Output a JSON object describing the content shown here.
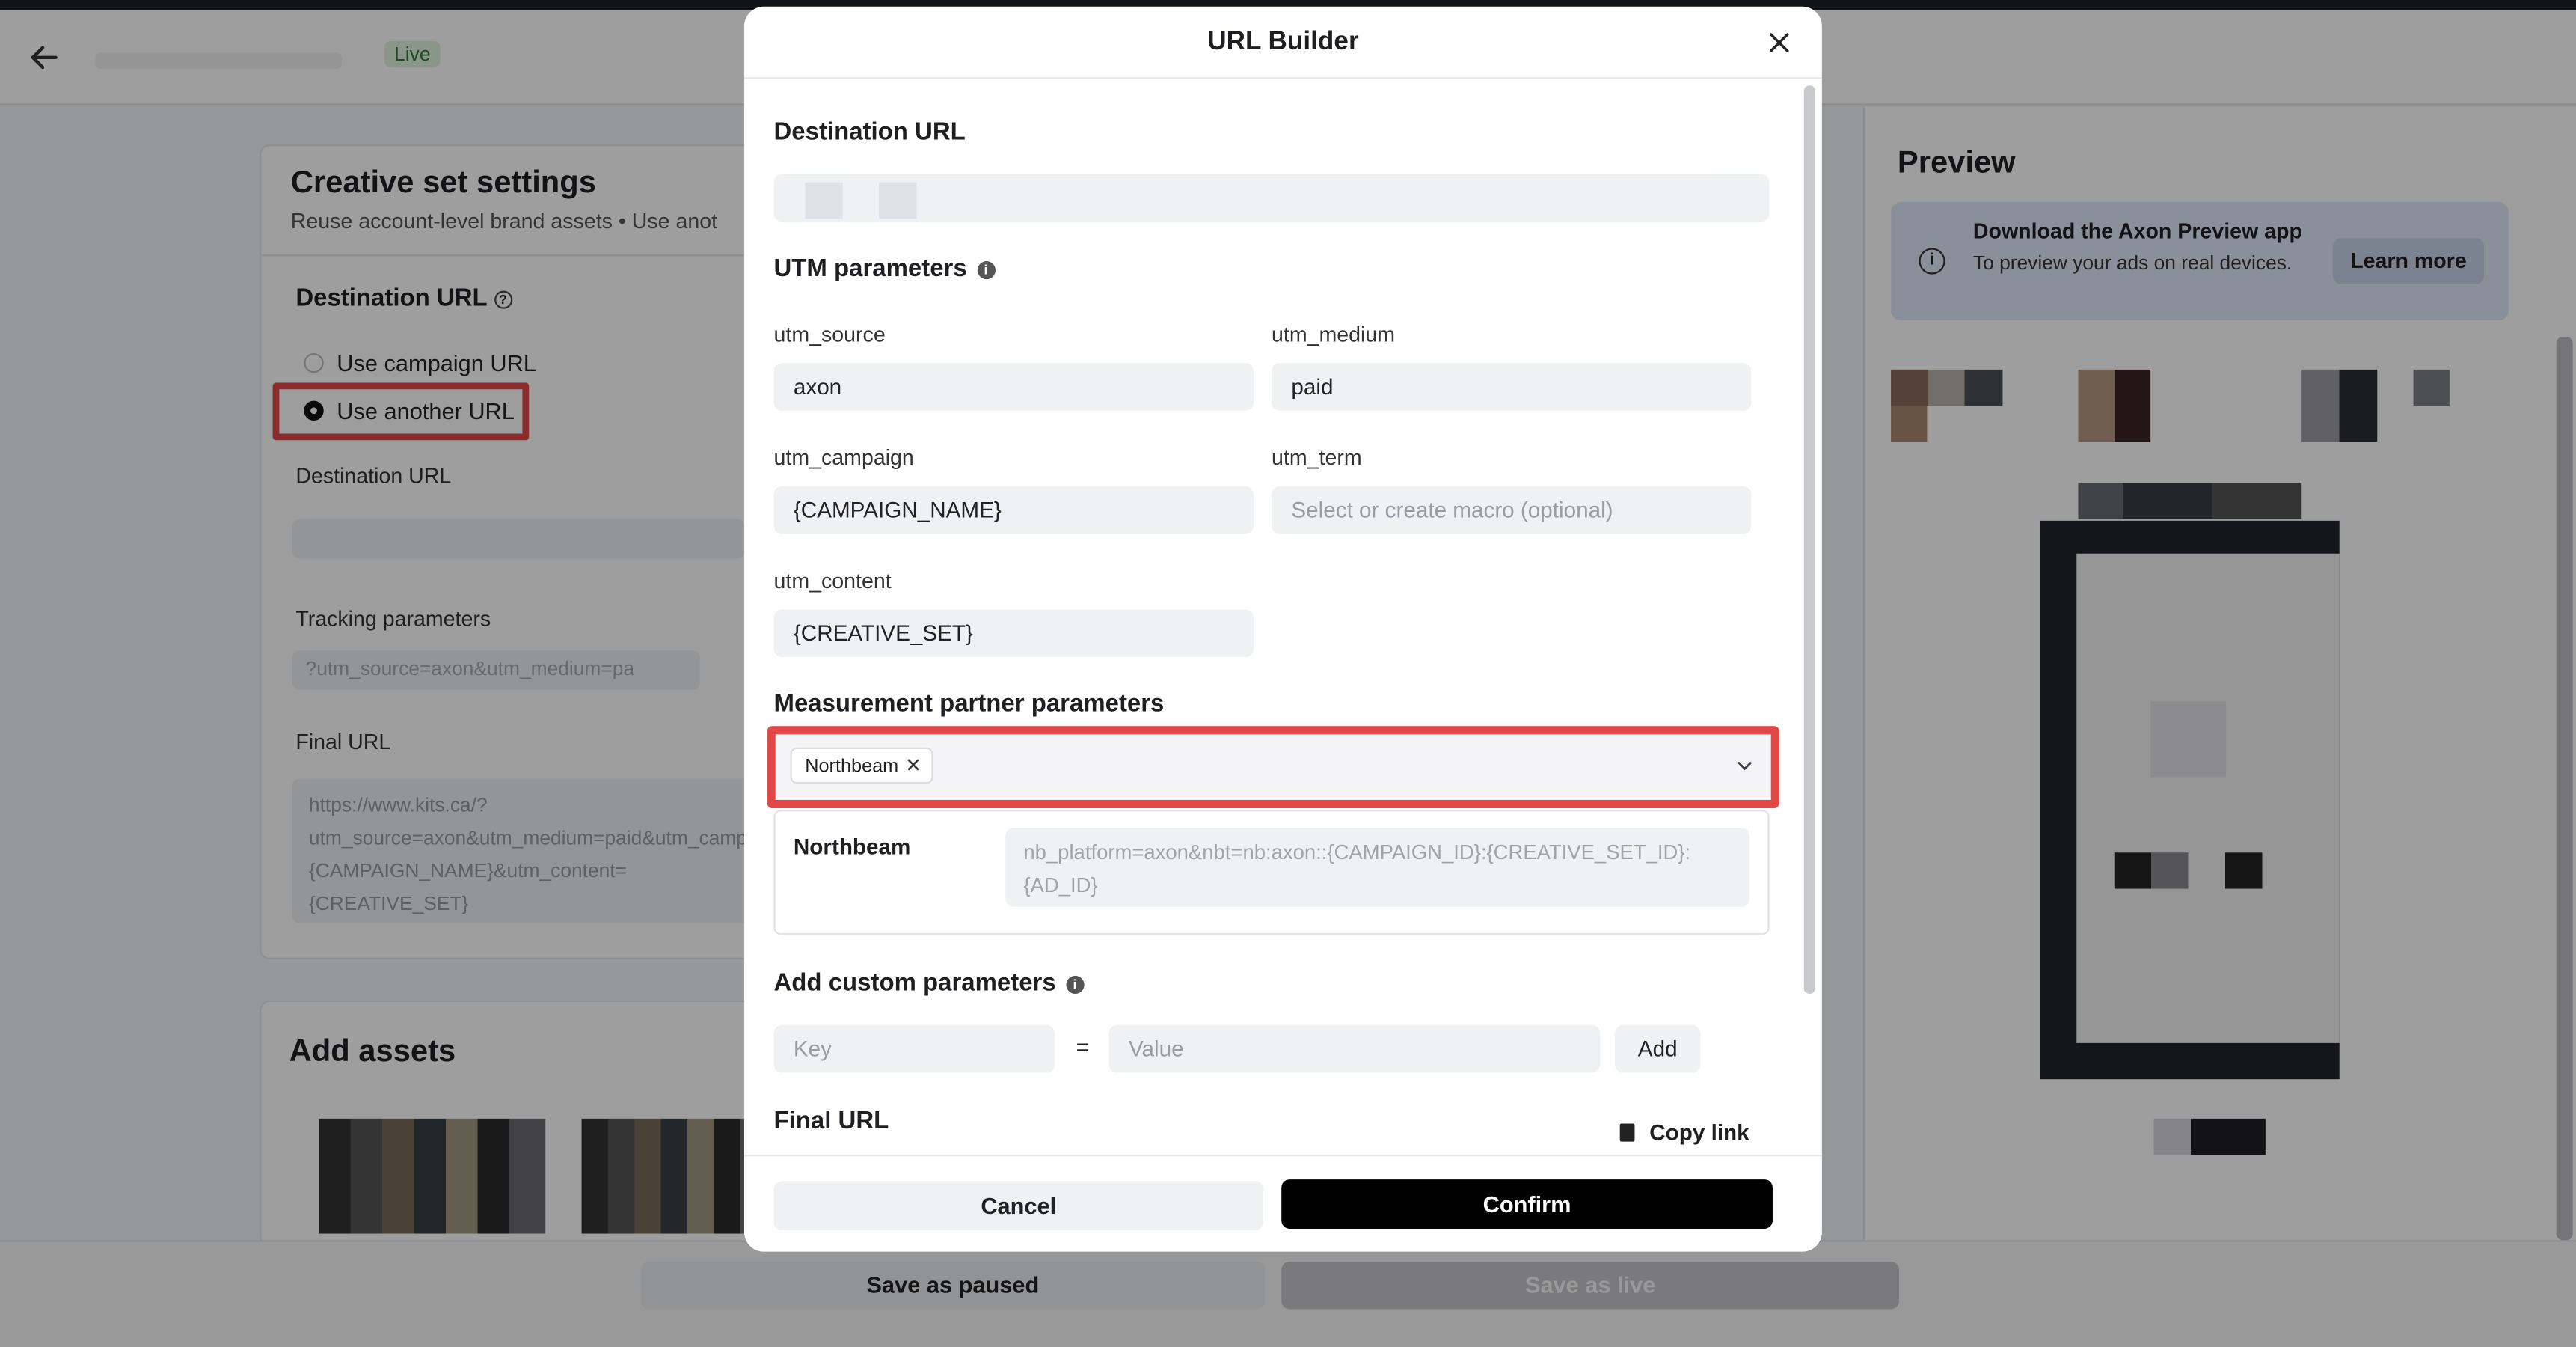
{
  "header": {
    "status_badge": "Live"
  },
  "settings_card": {
    "title": "Creative set settings",
    "subtitle": "Reuse account-level brand assets  •  Use anot",
    "destination_heading": "Destination URL",
    "radio_campaign_url": "Use campaign URL",
    "radio_another_url": "Use another URL",
    "destination_url_label": "Destination URL",
    "tracking_label": "Tracking parameters",
    "tracking_placeholder": "?utm_source=axon&utm_medium=pa",
    "final_url_label": "Final URL",
    "final_url_text": "https://www.kits.ca/?utm_source=axon&utm_medium=paid&utm_campaign={CAMPAIGN_NAME}&utm_content={CREATIVE_SET}"
  },
  "assets_card": {
    "title": "Add assets"
  },
  "preview": {
    "title": "Preview",
    "banner_title": "Download the Axon Preview app",
    "banner_text": "To preview your ads on real devices.",
    "learn_more": "Learn more"
  },
  "footer": {
    "save_paused": "Save as paused",
    "save_live": "Save as live"
  },
  "modal": {
    "title": "URL Builder",
    "destination_heading": "Destination URL",
    "utm_heading": "UTM parameters",
    "utm_source_label": "utm_source",
    "utm_source_value": "axon",
    "utm_medium_label": "utm_medium",
    "utm_medium_value": "paid",
    "utm_campaign_label": "utm_campaign",
    "utm_campaign_value": "{CAMPAIGN_NAME}",
    "utm_term_label": "utm_term",
    "utm_term_placeholder": "Select or create macro (optional)",
    "utm_content_label": "utm_content",
    "utm_content_value": "{CREATIVE_SET}",
    "partner_heading": "Measurement partner parameters",
    "partner_chip": "Northbeam",
    "partner_name": "Northbeam",
    "partner_value": "nb_platform=axon&nbt=nb:axon::{CAMPAIGN_ID}:{CREATIVE_SET_ID}:{AD_ID}",
    "custom_heading": "Add custom parameters",
    "key_placeholder": "Key",
    "equals": "=",
    "value_placeholder": "Value",
    "add_label": "Add",
    "final_url_heading": "Final URL",
    "copy_link": "Copy link",
    "cancel": "Cancel",
    "confirm": "Confirm"
  },
  "colors": {
    "highlight": "#e04848",
    "confirm_bg": "#000000",
    "banner_bg": "#dfe8f8",
    "live_badge_bg": "#dff3dd"
  }
}
